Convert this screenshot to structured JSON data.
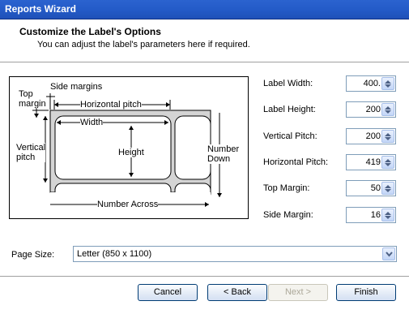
{
  "window": {
    "title": "Reports Wizard"
  },
  "header": {
    "title": "Customize the Label's Options",
    "subtitle": "You can adjust the label's parameters here if required."
  },
  "diagram": {
    "top_margin": "Top\nmargin",
    "side_margins": "Side margins",
    "horizontal_pitch": "Horizontal pitch",
    "width": "Width",
    "vertical_pitch": "Vertical\npitch",
    "height": "Height",
    "number_down": "Number\nDown",
    "number_across": "Number Across"
  },
  "fields": [
    {
      "label": "Label Width:",
      "value": "400."
    },
    {
      "label": "Label Height:",
      "value": "200"
    },
    {
      "label": "Vertical Pitch:",
      "value": "200"
    },
    {
      "label": "Horizontal Pitch:",
      "value": "419"
    },
    {
      "label": "Top Margin:",
      "value": "50"
    },
    {
      "label": "Side Margin:",
      "value": "16"
    }
  ],
  "page_size": {
    "label": "Page Size:",
    "value": "Letter (850 x 1100)"
  },
  "buttons": {
    "cancel": "Cancel",
    "back": "< Back",
    "next": "Next >",
    "finish": "Finish"
  },
  "colors": {
    "titlebar": "#245bc8",
    "label_fill": "#d4d4d4"
  },
  "icons": {
    "spin": "spin-updown-icon",
    "dropdown": "chevron-down-icon"
  }
}
